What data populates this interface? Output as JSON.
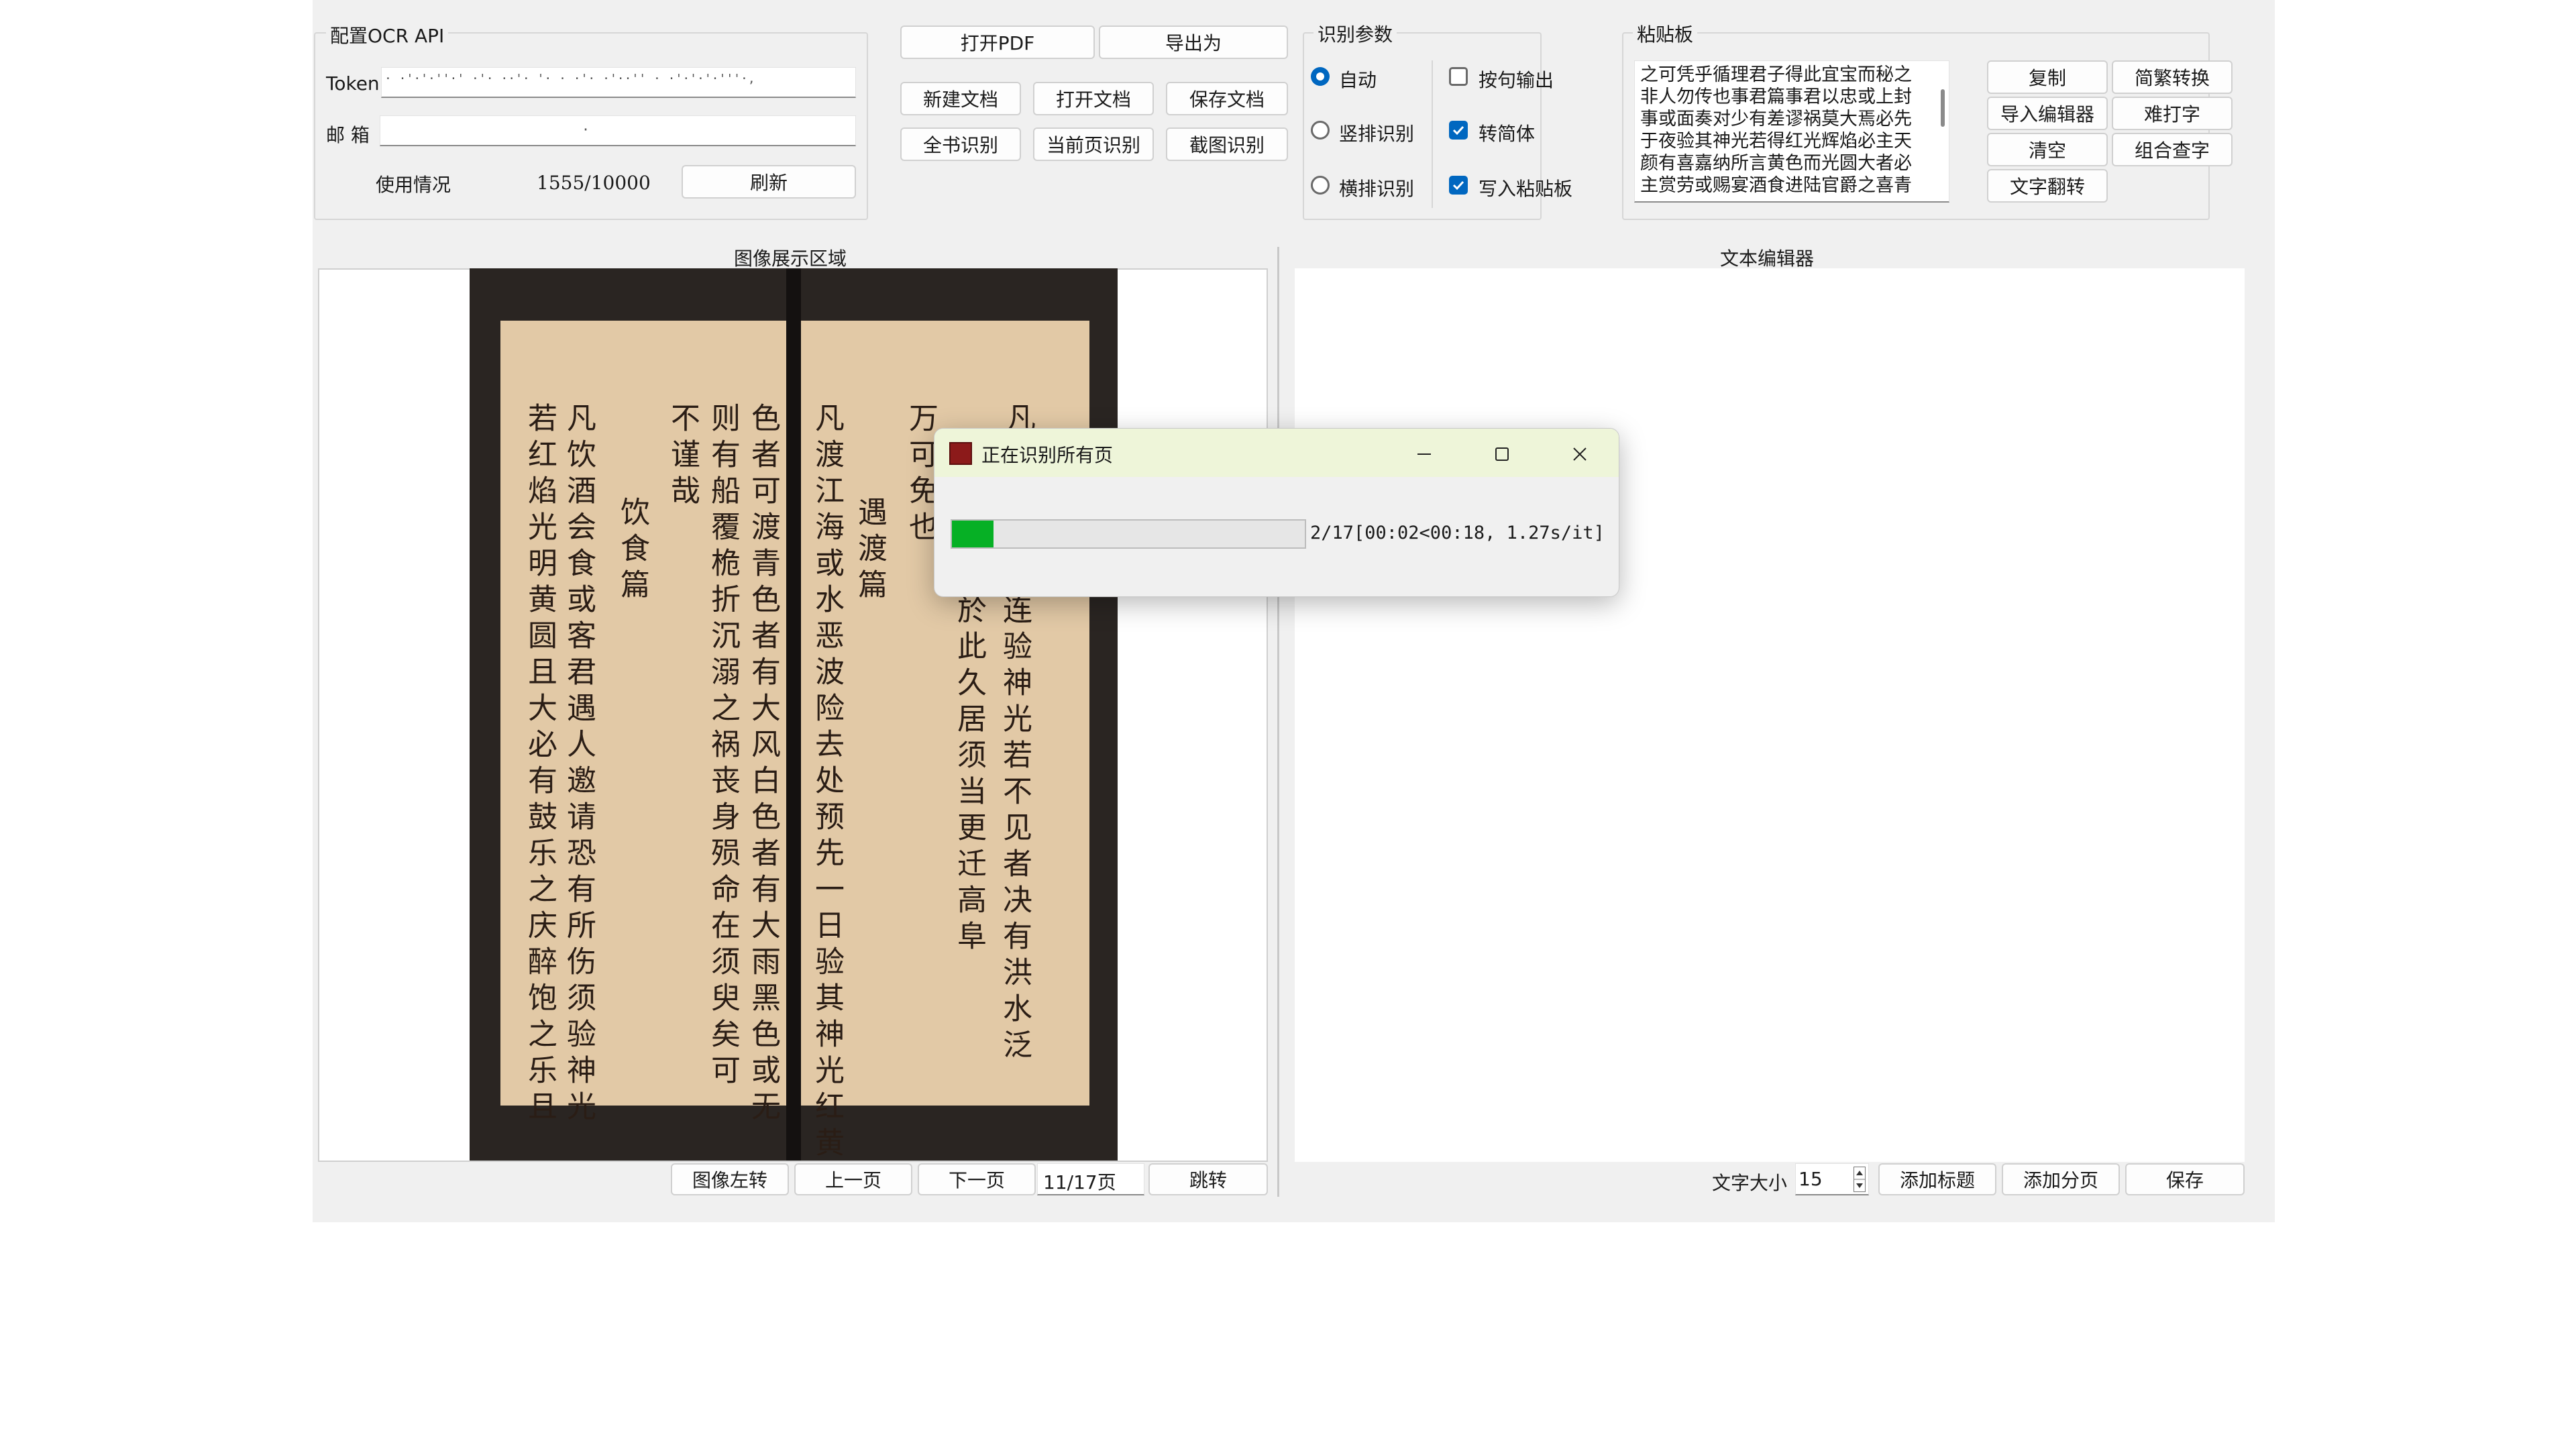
{
  "ocr_api": {
    "title": "配置OCR API",
    "token_label": "Token",
    "token_value": "· ·'·'·''·' ·'· ··'· '· · ·'· ·'··'' · ·'·'·'·'''·,",
    "email_label": "邮 箱",
    "email_value": "·",
    "usage_label": "使用情况",
    "usage_value": "1555/10000",
    "refresh_label": "刷新"
  },
  "file_buttons": {
    "open_pdf": "打开PDF",
    "export_as": "导出为",
    "new_doc": "新建文档",
    "open_doc": "打开文档",
    "save_doc": "保存文档",
    "full_ocr": "全书识别",
    "page_ocr": "当前页识别",
    "screenshot_ocr": "截图识别"
  },
  "ocr_params": {
    "title": "识别参数",
    "auto": "自动",
    "vertical": "竖排识别",
    "horizontal": "横排识别",
    "sentence_output": "按句输出",
    "to_simplified": "转简体",
    "to_clipboard": "写入粘贴板"
  },
  "clipboard": {
    "title": "粘贴板",
    "lines": [
      "之可凭乎循理君子得此宜宝而秘之",
      "非人勿传也事君篇事君以忠或上封",
      "事或面奏对少有差谬祸莫大焉必先",
      "于夜验其神光若得红光辉焰必主天",
      "颜有喜嘉纳所言黄色而光圆大者必",
      "主赏劳或赐宴酒食进陆官爵之喜青"
    ],
    "copy": "复制",
    "trad_simp": "简繁转换",
    "import_editor": "导入编辑器",
    "hard_char": "难打字",
    "clear": "清空",
    "combine_char": "组合查字",
    "translate": "文字翻转"
  },
  "image_area": {
    "title": "图像展示区域",
    "rotate_left": "图像左转",
    "prev_page": "上一页",
    "next_page": "下一页",
    "page_indicator": "11/17页",
    "jump": "跳转"
  },
  "editor": {
    "title": "文本编辑器",
    "font_size_label": "文字大小",
    "font_size_value": "15",
    "add_title": "添加标题",
    "add_page": "添加分页",
    "save": "保存"
  },
  "dialog": {
    "title": "正在识别所有页",
    "progress_text": "2/17[00:02<00:18, 1.27s/it]",
    "progress_fraction": 0.1176
  },
  "book_text": {
    "right_leaf": [
      "万可免也",
      "遇渡篇",
      "凡渡江海或水恶波险去处预先一日验其神光红黄",
      "色者可渡青色者有大风白色者有大雨黑色或无",
      "则有船覆桅折沉溺之祸丧身殒命在须臾矣可",
      "不谨哉"
    ],
    "left_leaf": [
      "饮食篇",
      "凡饮酒会食或客君遇人邀请恐有所伤须验神光",
      "若红焰光明黄圆且大必有鼓乐之庆醉饱之乐且"
    ],
    "far_right": [
      "凡",
      "恶风骤雨连验神光若不见者决有洪水泛",
      "之患不可於此久居须当更迁高阜"
    ]
  },
  "colors": {
    "accent": "#0067c0",
    "progress": "#06b025",
    "dialog_title_bg": "#eef5d9"
  }
}
